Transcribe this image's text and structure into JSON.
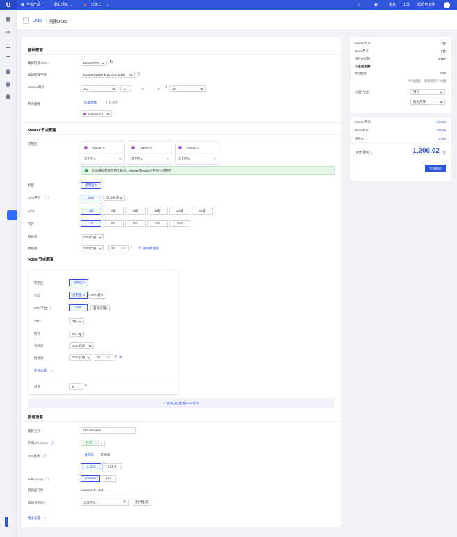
{
  "topbar": {
    "logo": "U",
    "product_menu": "全部产品",
    "project": "默认项目",
    "region": "北京二",
    "messages": "消息",
    "tickets": "工单",
    "help": "帮助与支持"
  },
  "sidebar": {
    "label": "收藏"
  },
  "breadcrumb": {
    "parent": "UK8S",
    "separator": "/",
    "current": "创建UK8S"
  },
  "basic": {
    "title": "基础配置",
    "vpc_label": "集群所属VPC",
    "vpc_value": "DefaultVPC",
    "subnet_label": "集群所属子网",
    "subnet_value": "Default Network(10.10.0.0/16)",
    "cidr_label": "Service网段",
    "cidr_a": "172",
    "cidr_b": "17",
    "cidr_c": "0",
    "cidr_d": "0",
    "cidr_mask": "16",
    "image_label": "节点镜像",
    "image_tab_std": "标准镜像",
    "image_tab_custom": "自有镜像",
    "image_value": "Centos 7.6"
  },
  "master": {
    "title": "Master 节点配置",
    "az_label": "可用区",
    "cards": [
      {
        "name": "Master A",
        "zone": "可用区D"
      },
      {
        "name": "Master B",
        "zone": "可用区D"
      },
      {
        "name": "Master C",
        "zone": "可用区D"
      }
    ],
    "notice": "您选择的是单可用区模式，Master和Node位于同一可用区",
    "model_label": "机型",
    "model_value": "通用型 N",
    "cpu_platform_label": "CPU平台",
    "cpu_platform_value": "Intel",
    "cpu_platform_auto": "自动分配",
    "cpu_label": "CPU",
    "cpu_options": [
      "2核",
      "4核",
      "8核",
      "16核",
      "24核",
      "32核"
    ],
    "mem_label": "内存",
    "mem_options": [
      "4G",
      "6G",
      "8G",
      "12G",
      "16G"
    ],
    "sysdisk_label": "系统盘",
    "sysdisk_value": "SSD云盘",
    "datadisk_label": "数据盘",
    "datadisk_value": "SSD云盘",
    "datadisk_size": "20",
    "datadisk_unit": "GB",
    "remove_disk": "删除数据盘"
  },
  "node": {
    "title": "Node 节点配置",
    "az_label": "可用区",
    "az_value": "可用区D",
    "model_label": "机型",
    "model_a": "通用型 N",
    "model_b": "GPU型 G",
    "cpu_platform_label": "CPU平台",
    "cpu_platform_value": "Intel",
    "cpu_platform_auto": "自动分配",
    "cpu_label": "CPU",
    "cpu_value": "2核",
    "mem_label": "内存",
    "mem_value": "4G",
    "sysdisk_label": "系统盘",
    "sysdisk_value": "SSD云盘",
    "datadisk_label": "数据盘",
    "datadisk_value": "SSD云盘",
    "datadisk_size": "20",
    "datadisk_unit": "GB",
    "more": "更多设置",
    "count_label": "数量",
    "count_value": "5",
    "add_node": "+ 新增其它配置node节点"
  },
  "manage": {
    "title": "管理设置",
    "name_label": "集群名称",
    "name_value": "UKubernetes",
    "apiserver_label": "外网APIServer",
    "apiserver_value": "打开",
    "k8s_label": "K8S版本",
    "k8s_tab_a": "推荐版",
    "k8s_tab_b": "其他版",
    "k8s_v1": "1.19.5",
    "k8s_v2": "1.18.9",
    "proxy_label": "kube-proxy",
    "proxy_a": "iptables",
    "proxy_b": "ipvs",
    "runtime_label": "容器运行时",
    "runtime_value": "containerd 1.4.3",
    "password_label": "管理员密码 *",
    "password_placeholder": "设置密码",
    "random_button": "随机生成",
    "more": "更多设置"
  },
  "summary": {
    "master_nodes_label": "Master节点",
    "master_nodes_value": "3台",
    "node_nodes_label": "Node节点",
    "node_nodes_value": "5台",
    "eip_label": "弹性IP配额",
    "eip_value": "1/180",
    "host_quota_title": "云主机配额",
    "zone_quota_label": "D区配额",
    "zone_quota_value": "8/30",
    "quota_note": "申请配额，请联系客户经理",
    "pay_label": "付费方式",
    "pay_value": "月付",
    "term_value": "购买月末",
    "price_master_label": "Master节点",
    "price_master_value": "445.63",
    "price_node_label": "Node节点",
    "price_node_value": "742.55",
    "price_eip_label": "弹性IP",
    "price_eip_value": "17.84",
    "total_label": "合计费用 ⌄",
    "total_value": "1,206.02",
    "total_unit": "元",
    "buy_button": "立即购买"
  },
  "colors": {
    "brand": "#2f55d8",
    "notice_bg": "#e6f7e9",
    "notice_icon": "#2fa84f"
  }
}
